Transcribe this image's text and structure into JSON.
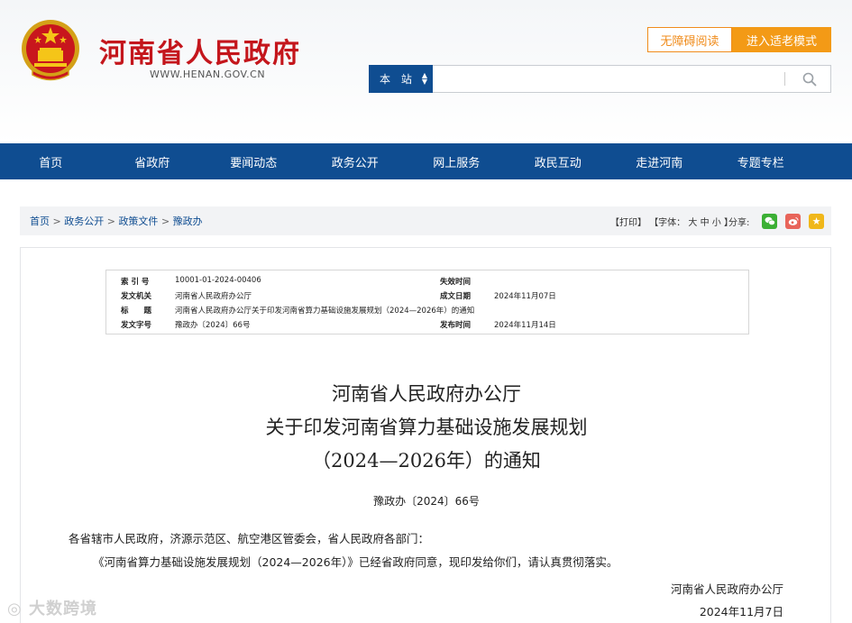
{
  "header": {
    "site_title": "河南省人民政府",
    "site_url": "WWW.HENAN.GOV.CN",
    "btn_accessible": "无障碍阅读",
    "btn_elder": "进入适老模式",
    "search_scope": "本 站",
    "search_placeholder": ""
  },
  "nav": {
    "items": [
      "首页",
      "省政府",
      "要闻动态",
      "政务公开",
      "网上服务",
      "政民互动",
      "走进河南",
      "专题专栏"
    ]
  },
  "breadcrumb": {
    "items": [
      "首页",
      "政务公开",
      "政策文件",
      "豫政办"
    ],
    "separator": ">"
  },
  "tools": {
    "print": "【打印】",
    "font_label": "【字体：",
    "font_large": "大",
    "font_medium": "中",
    "font_small": "小",
    "font_close": "】",
    "share_label": "分享:"
  },
  "meta": {
    "index_label": "索 引 号",
    "index_value": "10001-01-2024-00406",
    "expire_label": "失效时间",
    "expire_value": "",
    "issuer_label": "发文机关",
    "issuer_value": "河南省人民政府办公厅",
    "date_label": "成文日期",
    "date_value": "2024年11月07日",
    "title_label": "标　　题",
    "title_value": "河南省人民政府办公厅关于印发河南省算力基础设施发展规划（2024—2026年）的通知",
    "docno_label": "发文字号",
    "docno_value": "豫政办〔2024〕66号",
    "publish_label": "发布时间",
    "publish_value": "2024年11月14日"
  },
  "document": {
    "title_line1": "河南省人民政府办公厅",
    "title_line2": "关于印发河南省算力基础设施发展规划",
    "title_line3": "（2024—2026年）的通知",
    "doc_number": "豫政办〔2024〕66号",
    "salutation": "各省辖市人民政府，济源示范区、航空港区管委会，省人民政府各部门：",
    "body": "《河南省算力基础设施发展规划（2024—2026年）》已经省政府同意，现印发给你们，请认真贯彻落实。",
    "signer": "河南省人民政府办公厅",
    "sign_date": "2024年11月7日"
  },
  "watermark": "大数跨境",
  "colors": {
    "brand_red": "#c4161c",
    "nav_blue": "#0f4d91",
    "accent_orange": "#f39a16"
  }
}
